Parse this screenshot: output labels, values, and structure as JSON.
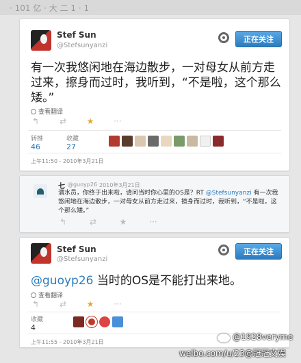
{
  "top_fragment": "· 101 亿 · 大 二 1 · 1",
  "tweet1": {
    "display_name": "Stef Sun",
    "handle": "@Stefsunyanzi",
    "follow_label": "正在关注",
    "text": "有一次我悠闲地在海边散步，一对母女从前方走过来，擦身而过时，我听到，“不是啦，这个那么矮。”",
    "translate_label": "查看翻译",
    "retweets_label": "转推",
    "retweets_value": "46",
    "favorites_label": "收藏",
    "favorites_value": "27",
    "timestamp": "上午11:50 - 2010年3月21日"
  },
  "reply": {
    "display_name": "七",
    "handle": "@guoyp26",
    "date": "2010年3月21日",
    "text_before": "潜水员，你终于出来啦，请问当时你心里的OS是？RT ",
    "mention": "@Stefsunyanzi",
    "text_after": " 有一次我悠闲地在海边散步，一对母女从前方走过来，擦身而过时，我听到，“不是啦，这个那么矮。”"
  },
  "tweet2": {
    "display_name": "Stef Sun",
    "handle": "@Stefsunyanzi",
    "follow_label": "正在关注",
    "mention": "@guoyp26",
    "text": " 当时的OS是不能打出来地。",
    "translate_label": "查看翻译",
    "favorites_label": "收藏",
    "favorites_value": "4",
    "timestamp": "上午11:55 - 2010年3月21日"
  },
  "icons": {
    "reply": "↰",
    "retweet": "⇄",
    "star": "★",
    "more": "···"
  },
  "watermark": {
    "line1": "@1928veryme",
    "line2": "weibo.com/u/23@冠冠文娱"
  },
  "colors": {
    "accent": "#2b7bbf",
    "star": "#e5a72a"
  }
}
